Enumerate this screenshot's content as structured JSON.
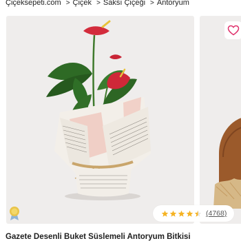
{
  "breadcrumb": [
    {
      "label": "Çiçeksepeti.com"
    },
    {
      "label": "Çiçek"
    },
    {
      "label": "Saksı Çiçeği"
    },
    {
      "label": "Antoryum"
    }
  ],
  "breadcrumb_separator": ">",
  "colors": {
    "accent_pink": "#e0336d",
    "star_yellow": "#f5b324",
    "card_bg": "#efedec",
    "anthurium_red": "#d32c3c",
    "leaf_green": "#2f6b2a"
  },
  "icons": {
    "favorite": "heart-outline-icon",
    "badge": "award-badge-icon",
    "rating": "star-icon"
  },
  "product": {
    "title": "Gazete Desenli Buket Süslemeli Antoryum Bitkisi",
    "rating_value": 4.5,
    "rating_max": 5,
    "rating_count": "(4768)"
  }
}
